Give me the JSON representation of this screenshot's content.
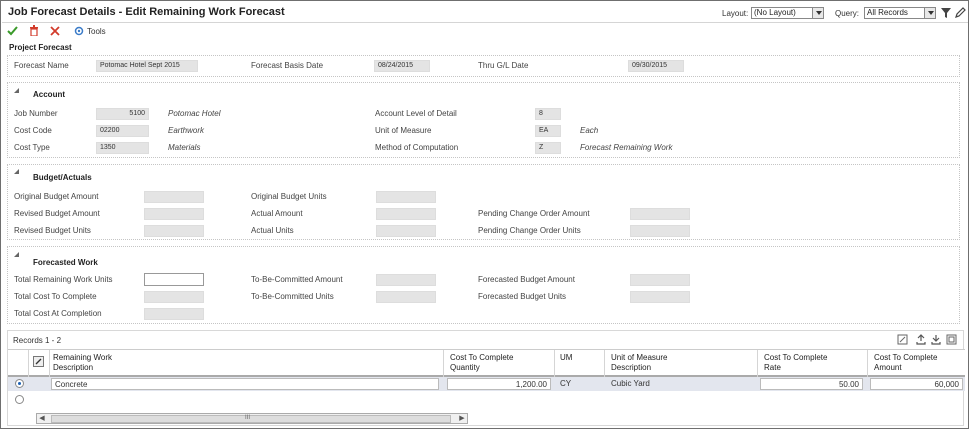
{
  "window": {
    "title": "Job Forecast Details - Edit Remaining Work Forecast",
    "layout_label": "Layout:",
    "layout_value": "(No Layout)",
    "query_label": "Query:",
    "query_value": "All Records"
  },
  "toolbar": {
    "ok_icon": "checkmark-icon",
    "delete_icon": "trash-icon",
    "cancel_icon": "close-icon",
    "tools_icon": "gear-icon",
    "tools_label": "Tools"
  },
  "project_forecast": {
    "heading": "Project Forecast",
    "forecast_name_label": "Forecast Name",
    "forecast_name_value": "Potomac Hotel Sept 2015",
    "forecast_basis_date_label": "Forecast Basis Date",
    "forecast_basis_date_value": "08/24/2015",
    "thru_gl_date_label": "Thru G/L Date",
    "thru_gl_date_value": "09/30/2015"
  },
  "account": {
    "heading": "Account",
    "job_number_label": "Job Number",
    "job_number_value": "5100",
    "job_number_desc": "Potomac Hotel",
    "cost_code_label": "Cost Code",
    "cost_code_value": "02200",
    "cost_code_desc": "Earthwork",
    "cost_type_label": "Cost Type",
    "cost_type_value": "1350",
    "cost_type_desc": "Materials",
    "level_of_detail_label": "Account Level of Detail",
    "level_of_detail_value": "8",
    "unit_of_measure_label": "Unit of Measure",
    "unit_of_measure_value": "EA",
    "unit_of_measure_desc": "Each",
    "method_label": "Method of Computation",
    "method_value": "Z",
    "method_desc": "Forecast Remaining Work"
  },
  "budget_actuals": {
    "heading": "Budget/Actuals",
    "original_budget_amount_label": "Original Budget Amount",
    "revised_budget_amount_label": "Revised Budget Amount",
    "revised_budget_units_label": "Revised Budget Units",
    "original_budget_units_label": "Original Budget Units",
    "actual_amount_label": "Actual Amount",
    "actual_units_label": "Actual Units",
    "pending_co_amount_label": "Pending Change Order Amount",
    "pending_co_units_label": "Pending Change Order Units"
  },
  "forecasted_work": {
    "heading": "Forecasted Work",
    "total_remaining_units_label": "Total Remaining Work Units",
    "total_cost_to_complete_label": "Total Cost To Complete",
    "total_cost_at_completion_label": "Total Cost At Completion",
    "tbc_amount_label": "To-Be-Committed Amount",
    "tbc_units_label": "To-Be-Committed Units",
    "forecast_budget_amount_label": "Forecasted Budget Amount",
    "forecast_budget_units_label": "Forecasted Budget Units"
  },
  "grid": {
    "records_label": "Records 1 - 2",
    "columns": [
      {
        "line1": "Remaining Work",
        "line2": "Description"
      },
      {
        "line1": "Cost To Complete",
        "line2": "Quantity"
      },
      {
        "line1": "UM",
        "line2": ""
      },
      {
        "line1": "Unit of Measure",
        "line2": "Description"
      },
      {
        "line1": "Cost To Complete",
        "line2": "Rate"
      },
      {
        "line1": "Cost To Complete",
        "line2": "Amount"
      }
    ],
    "rows": [
      {
        "description": "Concrete",
        "quantity": "1,200.00",
        "um": "CY",
        "um_desc": "Cubic Yard",
        "rate": "50.00",
        "amount": "60,000"
      }
    ],
    "scroll_mark": "III"
  }
}
